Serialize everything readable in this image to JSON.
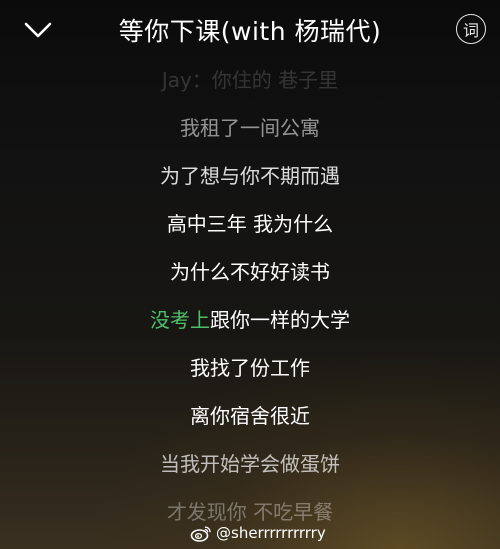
{
  "header": {
    "title": "等你下课(with 杨瑞代)",
    "back_icon": "chevron-down-icon",
    "lyric_mode_label": "词"
  },
  "lyrics": {
    "lines": [
      "Jay：你住的 巷子里",
      "我租了一间公寓",
      "为了想与你不期而遇",
      "高中三年 我为什么",
      "为什么不好好读书",
      "跟你一样的大学",
      "我找了份工作",
      "离你宿舍很近",
      "当我开始学会做蛋饼",
      "才发现你 不吃早餐"
    ],
    "current": {
      "sung": "没考上",
      "unsung": "跟你一样的大学",
      "highlight_color": "#4fc06a"
    }
  },
  "watermark": {
    "icon": "weibo-icon",
    "text": "@sherrrrrrrrrry"
  }
}
